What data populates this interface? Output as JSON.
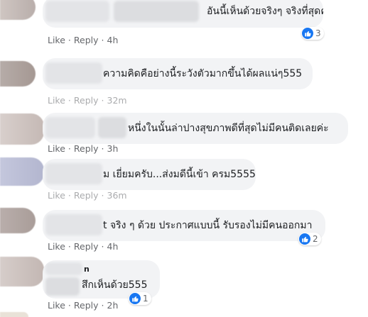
{
  "comments": [
    {
      "text": "อันนี้เห็นด้วยจริงๆ จริงที่สุดค่ะ",
      "like": "Like",
      "reply": "Reply",
      "time": "4h",
      "reactions": "3"
    },
    {
      "text": "ความคิดคือย่างนี้ระวังตัวมากขึ้นได้ผลแน่ๆ555",
      "like": "Like",
      "reply": "Reply",
      "time": "32m"
    },
    {
      "text": "หนึ่งในนั้นล่าปางสุขภาพดีที่สุดไม่มีคนติดเลยค่ะ",
      "like": "Like",
      "reply": "Reply",
      "time": "3h"
    },
    {
      "text": "ม เยี่ยมครับ...ส่งมดีนี้เข้า ครม5555",
      "like": "Like",
      "reply": "Reply",
      "time": "36m"
    },
    {
      "text": "t จริง ๆ ด้วย ประกาศแบบนี้ รับรองไม่มีคนออกมา",
      "like": "Like",
      "reply": "Reply",
      "time": "4h",
      "reactions": "2"
    },
    {
      "name_fragment": "n",
      "text": "สึกเห็นด้วย555",
      "like": "Like",
      "reply": "Reply",
      "time": "2h",
      "reactions": "1"
    }
  ],
  "colors": {
    "bubble": "#f2f3f5",
    "meta": "#65676b",
    "text": "#1c1e21",
    "like_blue": "#1877f2"
  },
  "icons": {
    "reaction": "thumbs-up-icon"
  }
}
